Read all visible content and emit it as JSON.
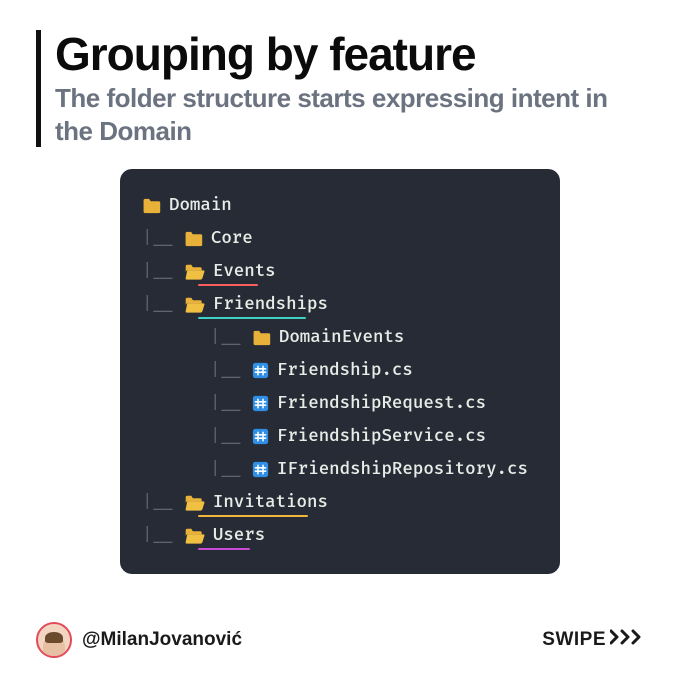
{
  "header": {
    "title": "Grouping by feature",
    "subtitle": "The folder structure starts expressing intent in the Domain"
  },
  "tree": {
    "rows": [
      {
        "indent": 0,
        "branch": "",
        "icon": "folder-yellow",
        "label": "Domain"
      },
      {
        "indent": 1,
        "branch": "|__ ",
        "icon": "folder-yellow",
        "label": "Core"
      },
      {
        "indent": 1,
        "branch": "|__ ",
        "icon": "folder-open",
        "label": "Events",
        "underline": "#ff5e5e",
        "ulw": 60
      },
      {
        "indent": 1,
        "branch": "|__ ",
        "icon": "folder-open",
        "label": "Friendships",
        "underline": "#3fd1c2",
        "ulw": 108
      },
      {
        "indent": 2,
        "branch": "|__ ",
        "icon": "folder-yellow",
        "label": "DomainEvents"
      },
      {
        "indent": 2,
        "branch": "|__ ",
        "icon": "cs-file",
        "label": "Friendship.cs"
      },
      {
        "indent": 2,
        "branch": "|__ ",
        "icon": "cs-file",
        "label": "FriendshipRequest.cs"
      },
      {
        "indent": 2,
        "branch": "|__ ",
        "icon": "cs-file",
        "label": "FriendshipService.cs"
      },
      {
        "indent": 2,
        "branch": "|__ ",
        "icon": "cs-file",
        "label": "IFriendshipRepository.cs"
      },
      {
        "indent": 1,
        "branch": "|__ ",
        "icon": "folder-open",
        "label": "Invitations",
        "underline": "#f3b63c",
        "ulw": 110
      },
      {
        "indent": 1,
        "branch": "|__ ",
        "icon": "folder-open",
        "label": "Users",
        "underline": "#c94bd6",
        "ulw": 52
      }
    ]
  },
  "footer": {
    "author": "@MilanJovanović",
    "swipe_label": "SWIPE"
  },
  "icons": {
    "folder_fill": "#E8B23A",
    "folder_open_fill": "#F0C043",
    "cs_fill": "#2F8FE6"
  }
}
